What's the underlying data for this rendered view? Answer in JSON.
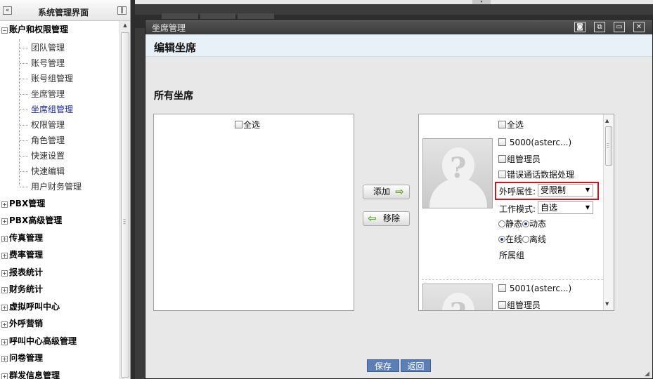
{
  "sidebar": {
    "title": "系统管理界面",
    "collapse_glyph": "«",
    "pin_glyph": "‖",
    "expanded_group": {
      "label": "账户和权限管理",
      "toggle": "−"
    },
    "children": [
      {
        "label": "团队管理"
      },
      {
        "label": "账号管理"
      },
      {
        "label": "账号组管理"
      },
      {
        "label": "坐席管理"
      },
      {
        "label": "坐席组管理"
      },
      {
        "label": "权限管理"
      },
      {
        "label": "角色管理"
      },
      {
        "label": "快速设置"
      },
      {
        "label": "快速编辑"
      },
      {
        "label": "用户财务管理"
      }
    ],
    "selected_child": "坐席组管理",
    "groups": [
      {
        "label": "PBX管理",
        "toggle": "+"
      },
      {
        "label": "PBX高级管理",
        "toggle": "+"
      },
      {
        "label": "传真管理",
        "toggle": "+"
      },
      {
        "label": "费率管理",
        "toggle": "+"
      },
      {
        "label": "报表统计",
        "toggle": "+"
      },
      {
        "label": "财务统计",
        "toggle": "+"
      },
      {
        "label": "虚拟呼叫中心",
        "toggle": "+"
      },
      {
        "label": "外呼营销",
        "toggle": "+"
      },
      {
        "label": "呼叫中心高级管理",
        "toggle": "+"
      },
      {
        "label": "问卷管理",
        "toggle": "+"
      },
      {
        "label": "群发信息管理",
        "toggle": "+"
      }
    ]
  },
  "dialog": {
    "title": "坐席管理",
    "header_title": "编辑坐席",
    "section_title": "所有坐席",
    "window_buttons": [
      "◙",
      "⧉",
      "▭",
      "✕"
    ],
    "left_list": {
      "select_all": "全选"
    },
    "right_list": {
      "select_all": "全选",
      "agents": [
        {
          "name": "5000(asterc...)",
          "group_admin": "组管理员",
          "error_handling": "错误通话数据处理",
          "outbound_label": "外呼属性:",
          "outbound_value": "受限制",
          "work_mode_label": "工作模式:",
          "work_mode_value": "自选",
          "mode_static": "静态",
          "mode_dynamic": "动态",
          "mode_selected": "动态",
          "status_online": "在线",
          "status_offline": "离线",
          "status_selected": "在线",
          "group_label": "所属组"
        },
        {
          "name": "5001(asterc...)",
          "group_admin": "组管理员"
        }
      ]
    },
    "add_button": {
      "label": "添加",
      "icon": "right-arrow-icon",
      "glyph": "⇨"
    },
    "remove_button": {
      "label": "移除",
      "icon": "left-arrow-icon",
      "glyph": "⇦"
    },
    "save_button": "保存",
    "back_button": "返回"
  },
  "colors": {
    "highlight_border": "#d4141a",
    "selected_tree_item": "#1a2a9e",
    "footer_button": "#5b7fb5",
    "dialog_header_bg": "#e8f1f8"
  }
}
